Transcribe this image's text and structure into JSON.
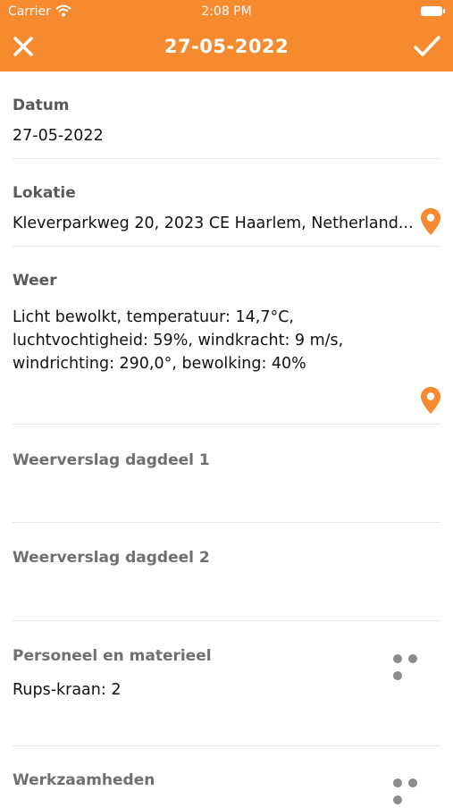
{
  "status_bar": {
    "carrier": "Carrier",
    "time": "2:08 PM"
  },
  "header": {
    "title": "27-05-2022"
  },
  "fields": {
    "datum": {
      "label": "Datum",
      "value": "27-05-2022"
    },
    "lokatie": {
      "label": "Lokatie",
      "value": "Kleverparkweg 20, 2023 CE Haarlem, Netherland..."
    },
    "weer": {
      "label": "Weer",
      "line1": "Licht bewolkt, temperatuur: 14,7°C,",
      "line2": "luchtvochtigheid: 59%, windkracht: 9 m/s,",
      "line3": "windrichting: 290,0°, bewolking: 40%"
    },
    "weerverslag1": {
      "label": "Weerverslag dagdeel 1"
    },
    "weerverslag2": {
      "label": "Weerverslag dagdeel 2"
    },
    "personeel": {
      "label": "Personeel en materieel",
      "value": "Rups-kraan: 2"
    },
    "werkzaamheden": {
      "label": "Werkzaamheden"
    }
  },
  "colors": {
    "accent": "#F58A2E",
    "header_text": "#FFFFFF"
  },
  "icons": {
    "close": "close-icon",
    "save": "checkmark-icon",
    "location": "location-pin-icon",
    "more": "more-dots-icon"
  }
}
